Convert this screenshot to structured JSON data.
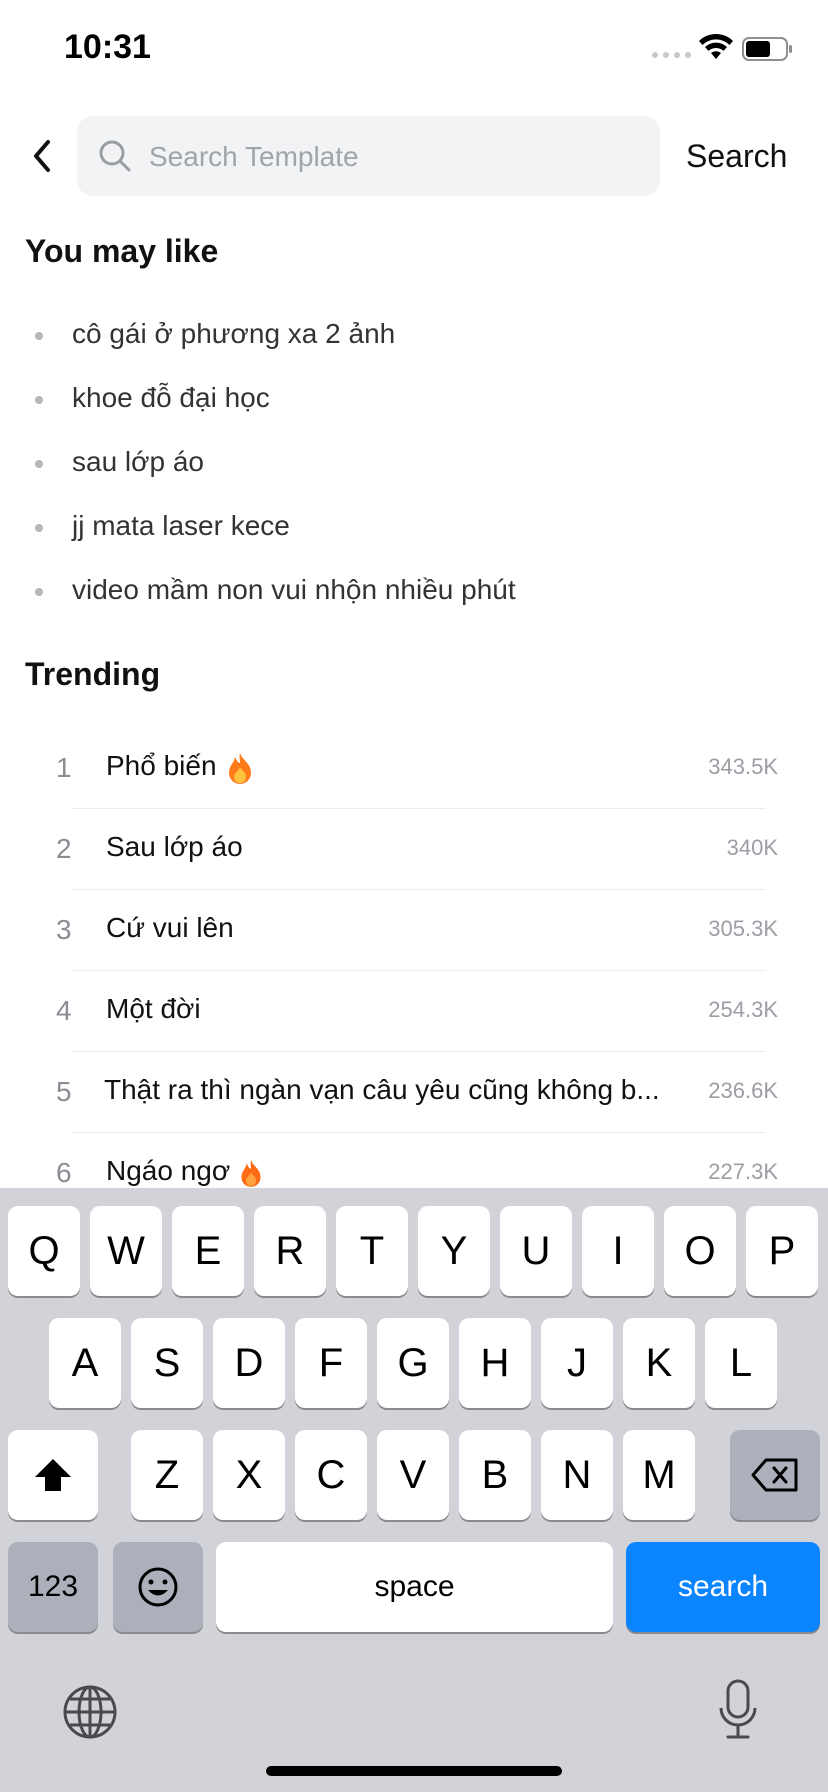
{
  "status": {
    "time": "10:31"
  },
  "search": {
    "placeholder": "Search Template",
    "value": "",
    "button_label": "Search"
  },
  "you_may_like": {
    "title": "You may like",
    "items": [
      "cô gái ở phương xa 2 ảnh",
      "khoe đỗ đại học",
      "sau lớp áo",
      "jj mata laser kece",
      "video mầm non vui nhộn nhiều phút"
    ]
  },
  "trending": {
    "title": "Trending",
    "items": [
      {
        "rank": "1",
        "title": "Phổ biến",
        "count": "343.5K",
        "fire": true
      },
      {
        "rank": "2",
        "title": "Sau lớp áo",
        "count": "340K",
        "fire": false
      },
      {
        "rank": "3",
        "title": "Cứ vui lên",
        "count": "305.3K",
        "fire": false
      },
      {
        "rank": "4",
        "title": "Một đời",
        "count": "254.3K",
        "fire": false
      },
      {
        "rank": "5",
        "title": "Thật ra thì ngàn vạn câu yêu cũng không b...",
        "count": "236.6K",
        "fire": false
      },
      {
        "rank": "6",
        "title": "Ngáo ngơ",
        "count": "227.3K",
        "fire": true
      }
    ]
  },
  "keyboard": {
    "row1": [
      "Q",
      "W",
      "E",
      "R",
      "T",
      "Y",
      "U",
      "I",
      "O",
      "P"
    ],
    "row2": [
      "A",
      "S",
      "D",
      "F",
      "G",
      "H",
      "J",
      "K",
      "L"
    ],
    "row3": [
      "Z",
      "X",
      "C",
      "V",
      "B",
      "N",
      "M"
    ],
    "numbers_label": "123",
    "space_label": "space",
    "search_label": "search"
  },
  "colors": {
    "accent": "#0a84ff",
    "keyboard_bg": "#d1d3d9"
  }
}
